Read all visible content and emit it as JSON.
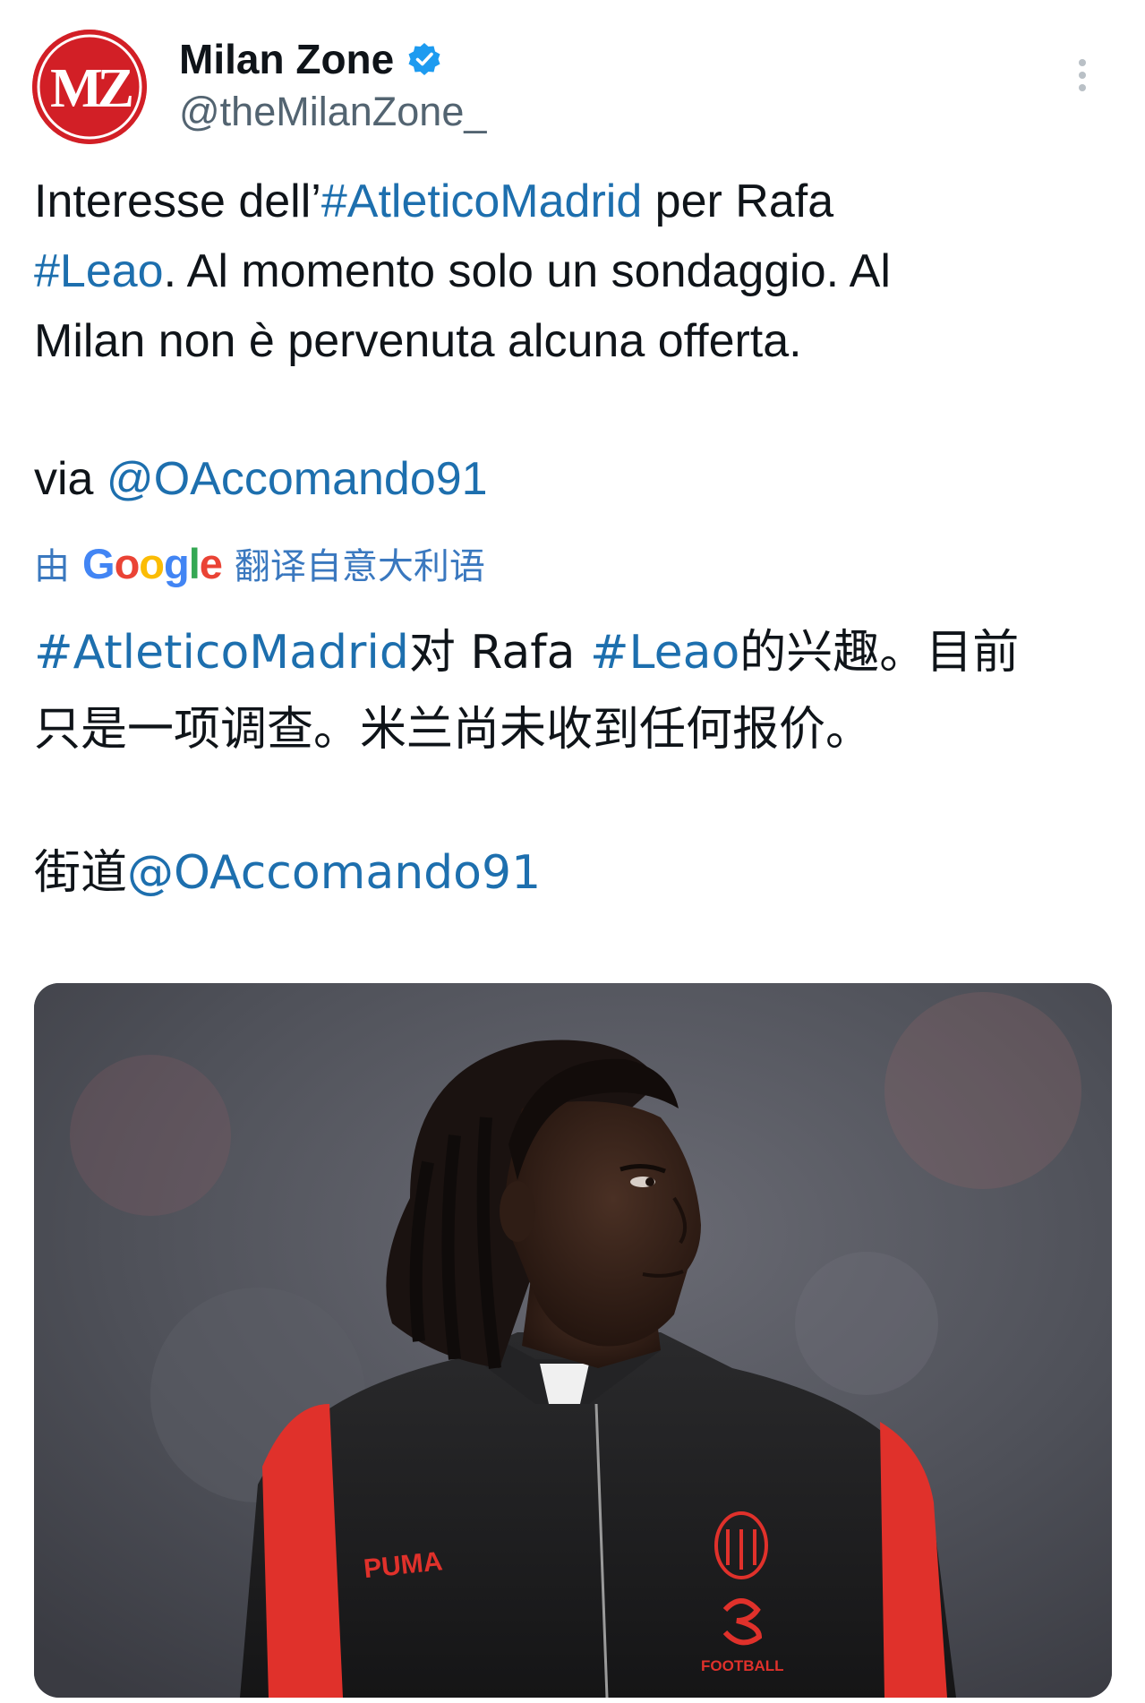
{
  "account": {
    "display_name": "Milan Zone",
    "handle": "@theMilanZone_",
    "avatar_text": "MZ",
    "verified": true
  },
  "tweet": {
    "line1_pre": "Interesse dell’",
    "hashtag_atletico": "#AtleticoMadrid",
    "line1_post": " per Rafa",
    "hashtag_leao": "#Leao",
    "line2_post": ". Al momento solo un sondaggio. Al",
    "line3": "Milan non è pervenuta alcuna offerta.",
    "via_label": "via ",
    "via_mention": "@OAccomando91"
  },
  "translation": {
    "prefix": "由",
    "google": "Google",
    "suffix": "翻译自意大利语",
    "line1_hashtag_atletico": "#AtleticoMadrid",
    "line1_mid": "对 Rafa ",
    "line1_hashtag_leao": "#Leao",
    "line1_post": "的兴趣。目前",
    "line2": "只是一项调查。米兰尚未收到任何报价。",
    "via_label": "街道",
    "via_mention": "@OAccomando91"
  },
  "media": {
    "jacket_brand": "PUMA",
    "sponsor_text": "FOOTBALL"
  },
  "colors": {
    "link": "#1d6fae",
    "avatar_red": "#d21f26",
    "verified_blue": "#1d9bf0",
    "jacket_red": "#e0312b"
  }
}
